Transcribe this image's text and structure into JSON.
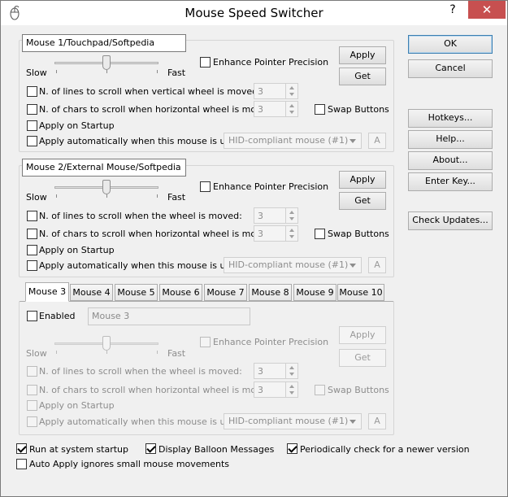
{
  "window": {
    "title": "Mouse Speed Switcher",
    "help_glyph": "?",
    "close_glyph": "✕"
  },
  "mouse1": {
    "name": "Mouse 1/Touchpad/Softpedia",
    "slow": "Slow",
    "fast": "Fast",
    "enhance": "Enhance Pointer Precision",
    "apply": "Apply",
    "get": "Get",
    "lines_label": "N. of lines to scroll when vertical wheel is moved:",
    "lines_value": "3",
    "chars_label": "N. of chars to scroll when  horizontal wheel is moved:",
    "chars_value": "3",
    "swap": "Swap Buttons",
    "startup": "Apply on Startup",
    "auto": "Apply automatically when this mouse is used:",
    "device": "HID-compliant mouse (#1)",
    "a_button": "A",
    "speed_level": 0.5
  },
  "mouse2": {
    "name": "Mouse 2/External Mouse/Softpedia",
    "slow": "Slow",
    "fast": "Fast",
    "enhance": "Enhance Pointer Precision",
    "apply": "Apply",
    "get": "Get",
    "lines_label": "N. of lines to scroll when the wheel is moved:",
    "lines_value": "3",
    "chars_label": "N. of chars to scroll when  horizontal wheel is moved:",
    "chars_value": "3",
    "swap": "Swap Buttons",
    "startup": "Apply on Startup",
    "auto": "Apply automatically when this mouse is used:",
    "device": "HID-compliant mouse (#1)",
    "a_button": "A",
    "speed_level": 0.5
  },
  "tabs": [
    "Mouse 3",
    "Mouse 4",
    "Mouse 5",
    "Mouse 6",
    "Mouse 7",
    "Mouse 8",
    "Mouse 9",
    "Mouse 10"
  ],
  "mouse3": {
    "enabled": "Enabled",
    "name": "Mouse 3",
    "slow": "Slow",
    "fast": "Fast",
    "enhance": "Enhance Pointer Precision",
    "apply": "Apply",
    "get": "Get",
    "lines_label": "N. of lines to scroll when the wheel is moved:",
    "lines_value": "3",
    "chars_label": "N. of chars to scroll when  horizontal wheel is moved:",
    "chars_value": "3",
    "swap": "Swap Buttons",
    "startup": "Apply on Startup",
    "auto": "Apply automatically when this mouse is used:",
    "device": "HID-compliant mouse (#1)",
    "a_button": "A",
    "speed_level": 0.5
  },
  "side": {
    "ok": "OK",
    "cancel": "Cancel",
    "hotkeys": "Hotkeys...",
    "help": "Help...",
    "about": "About...",
    "enter_key": "Enter Key...",
    "check_updates": "Check Updates..."
  },
  "bottom": {
    "run_startup": "Run at system startup",
    "balloon": "Display Balloon Messages",
    "check_newer": "Periodically check for a newer version",
    "auto_apply": "Auto Apply ignores small mouse movements"
  },
  "colors": {
    "close_button": "#c75050",
    "window_bg": "#f0f0f0"
  }
}
